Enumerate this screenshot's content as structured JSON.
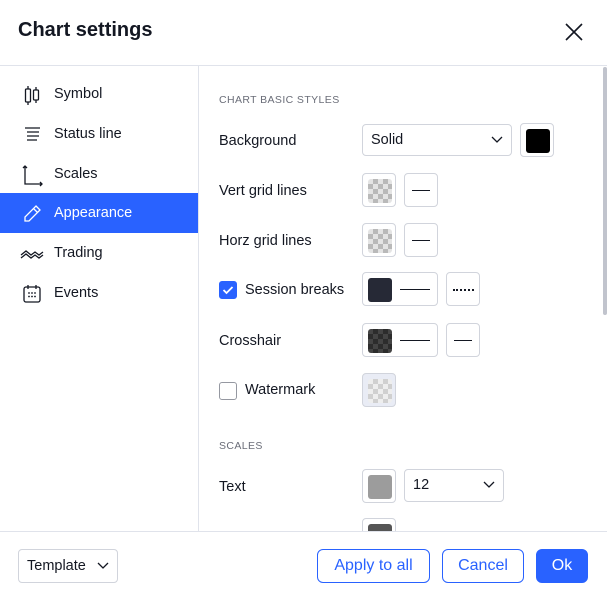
{
  "header": {
    "title": "Chart settings",
    "close_icon": "close-icon"
  },
  "sidebar": {
    "items": [
      {
        "label": "Symbol",
        "icon": "candlestick-icon",
        "active": false
      },
      {
        "label": "Status line",
        "icon": "status-line-icon",
        "active": false
      },
      {
        "label": "Scales",
        "icon": "scales-icon",
        "active": false
      },
      {
        "label": "Appearance",
        "icon": "pencil-icon",
        "active": true
      },
      {
        "label": "Trading",
        "icon": "trading-icon",
        "active": false
      },
      {
        "label": "Events",
        "icon": "calendar-icon",
        "active": false
      }
    ]
  },
  "content": {
    "section_basic": "CHART BASIC STYLES",
    "background": {
      "label": "Background",
      "select_value": "Solid",
      "color": "#000000"
    },
    "vert_grid": {
      "label": "Vert grid lines"
    },
    "horz_grid": {
      "label": "Horz grid lines"
    },
    "session_breaks": {
      "label": "Session breaks",
      "checked": true,
      "color": "#262936"
    },
    "crosshair": {
      "label": "Crosshair"
    },
    "watermark": {
      "label": "Watermark",
      "checked": false
    },
    "section_scales": "SCALES",
    "text": {
      "label": "Text",
      "color": "#9c9c9c",
      "font_size": "12"
    },
    "lines_color": "#555555"
  },
  "footer": {
    "template_label": "Template",
    "apply_all_label": "Apply to all",
    "cancel_label": "Cancel",
    "ok_label": "Ok"
  },
  "colors": {
    "accent": "#2962ff",
    "border": "#d1d4dc",
    "text": "#131722",
    "muted": "#6a6d78"
  }
}
